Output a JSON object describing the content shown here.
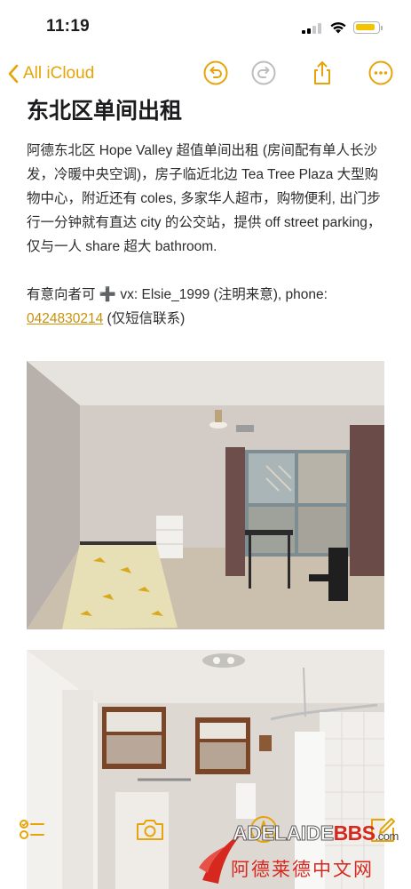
{
  "status_bar": {
    "time": "11:19",
    "battery_color": "#f5c400"
  },
  "nav": {
    "back_label": "All iCloud",
    "icons": [
      "chevron-left-icon",
      "undo-icon",
      "redo-icon",
      "share-icon",
      "more-icon"
    ],
    "accent_color": "#e5a50a"
  },
  "note": {
    "title": "东北区单间出租",
    "body": "阿德东北区 Hope Valley 超值单间出租 (房间配有单人长沙发，冷暖中央空调)，房子临近北边 Tea Tree Plaza 大型购物中心，附近还有 coles, 多家华人超市，购物便利, 出门步行一分钟就有直达 city 的公交站，提供 off street parking，仅与一人 share 超大 bathroom.",
    "contact_prefix": "有意向者可 ➕ vx: Elsie_1999 (注明来意), phone: ",
    "phone": "0424830214",
    "contact_suffix": " (仅短信联系)"
  },
  "photos": [
    "bedroom-photo",
    "bathroom-photo"
  ],
  "toolbar": {
    "icons": [
      "checklist-icon",
      "camera-icon",
      "markup-icon",
      "compose-icon"
    ]
  },
  "watermark": {
    "line1_a": "ADELAIDE",
    "line1_b": "BBS",
    "line1_c": ".com",
    "line2": "阿德莱德中文网"
  }
}
